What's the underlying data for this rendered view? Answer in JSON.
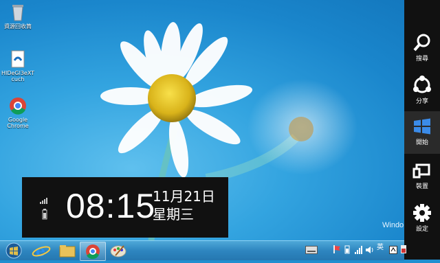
{
  "desktop": {
    "icons": [
      {
        "name": "recycle-bin-icon",
        "label": "資源回收筒"
      },
      {
        "name": "hidegl-file-icon",
        "label": "HIDeGl3eXT\ncuch"
      },
      {
        "name": "google-chrome-icon",
        "label": "Google\nChrome"
      }
    ],
    "watermark": "Windo"
  },
  "clock": {
    "time": "08:15",
    "date": "11月21日",
    "weekday": "星期三"
  },
  "charms": [
    {
      "label": "搜尋",
      "icon": "search-icon"
    },
    {
      "label": "分享",
      "icon": "share-icon"
    },
    {
      "label": "開始",
      "icon": "windows-start-icon"
    },
    {
      "label": "裝置",
      "icon": "devices-icon"
    },
    {
      "label": "設定",
      "icon": "settings-gear-icon"
    }
  ],
  "taskbar": {
    "buttons": [
      "start-orb",
      "internet-explorer",
      "file-explorer",
      "google-chrome",
      "paint"
    ]
  }
}
